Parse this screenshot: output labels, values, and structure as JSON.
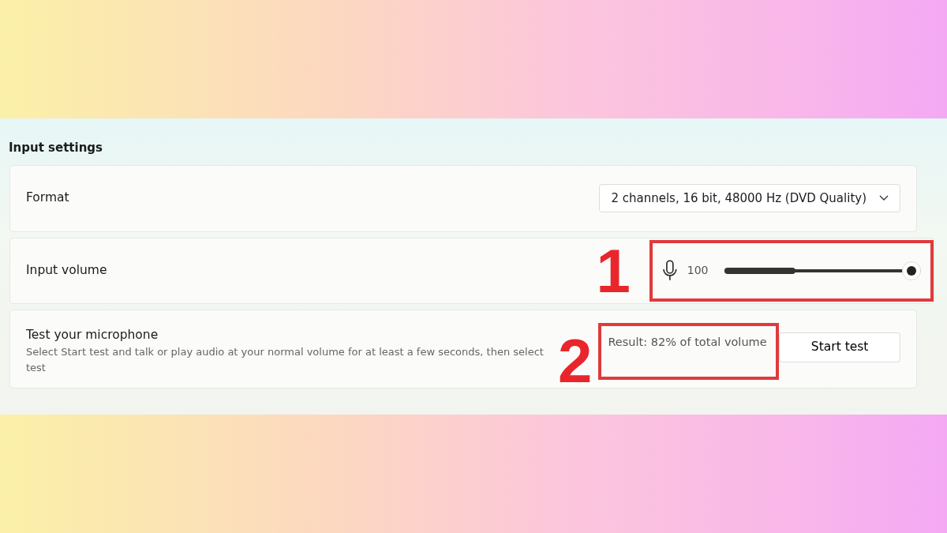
{
  "section": {
    "title": "Input settings"
  },
  "rows": [
    {
      "kind": "dropdown",
      "label": "Format",
      "value": "2 channels, 16 bit, 48000 Hz (DVD Quality)"
    },
    {
      "kind": "slider",
      "label": "Input volume",
      "reading": "100",
      "level": 1,
      "meter": {
        "level": 0.36
      },
      "annotation": "1"
    },
    {
      "kind": "test",
      "label": "Test your microphone",
      "description_lines": [
        "Select Start test and talk or play audio at your normal volume for at least a few seconds, then select",
        "test"
      ],
      "result": "Result: 82% of total volume",
      "annotation": "2",
      "button": "Start test"
    }
  ]
}
